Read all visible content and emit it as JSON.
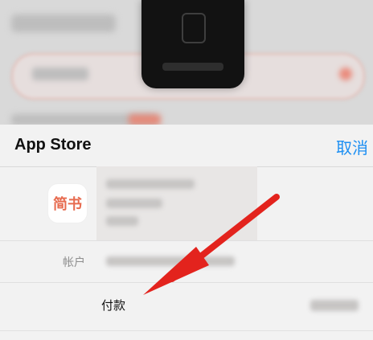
{
  "sheet": {
    "title": "App Store",
    "cancel_label": "取消"
  },
  "app": {
    "icon_text": "简书"
  },
  "account": {
    "label": "帐户"
  },
  "payment": {
    "label": "付款"
  },
  "colors": {
    "accent_blue": "#1c8ff3",
    "arrow_red": "#e3231d",
    "app_icon_text": "#e76b4f"
  }
}
